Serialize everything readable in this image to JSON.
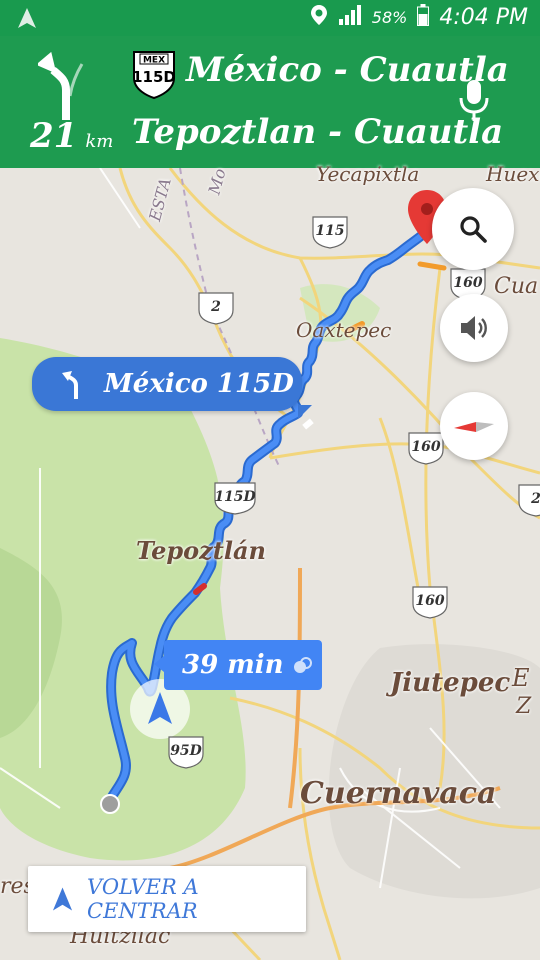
{
  "status": {
    "battery": "58%",
    "time": "4:04 PM"
  },
  "nav": {
    "distance": "21",
    "distance_unit": "km",
    "shield_mex": "MEX",
    "shield_num": "115D",
    "road_primary": "México - Cuautla",
    "road_secondary": "Tepoztlan - Cuautla"
  },
  "callout": {
    "text": "México 115D"
  },
  "eta": {
    "text": "39 min"
  },
  "recenter": {
    "label": "VOLVER A CENTRAR"
  },
  "places": {
    "yecapixtla": "Yecapixtla",
    "huexca": "Huexc",
    "oaxtepec": "Oaxtepec",
    "tepoztlan": "Tepoztlán",
    "jiutepec": "Jiutepec",
    "cuernavaca": "Cuernavaca",
    "huitzilac": "Huitzilac",
    "cuautla_partial": "Cua",
    "esta_partial": "ESTA",
    "mo_partial": "Mo",
    "tres_partial": "res",
    "e_partial": "E",
    "z_partial": "Z"
  },
  "shields": {
    "s115": "115",
    "s160a": "160",
    "s2": "2",
    "s160b": "160",
    "s115d": "115D",
    "s160c": "160",
    "s95d": "95D",
    "s2b": "2"
  },
  "colors": {
    "header": "#1e9b50",
    "route": "#4285f4",
    "callout": "#3a77d6",
    "destination": "#e53935"
  }
}
